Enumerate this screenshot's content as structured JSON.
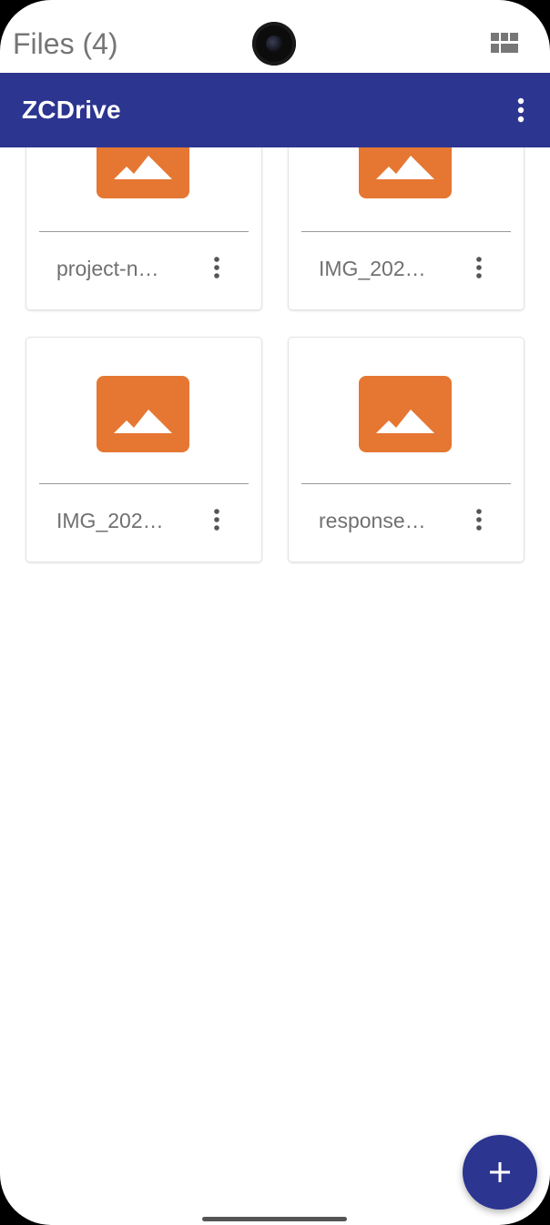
{
  "header": {
    "files_title": "Files (4)",
    "view_toggle_icon": "grid-view-icon"
  },
  "appbar": {
    "title": "ZCDrive",
    "menu_icon": "more-vert-icon",
    "color": "#2c3590"
  },
  "files": [
    {
      "name": "project-n…",
      "icon": "image-icon",
      "menu_icon": "more-vert-icon"
    },
    {
      "name": "IMG_202…",
      "icon": "image-icon",
      "menu_icon": "more-vert-icon"
    },
    {
      "name": "IMG_202…",
      "icon": "image-icon",
      "menu_icon": "more-vert-icon"
    },
    {
      "name": "response…",
      "icon": "image-icon",
      "menu_icon": "more-vert-icon"
    }
  ],
  "fab": {
    "icon": "add-icon",
    "color": "#2c3590"
  },
  "colors": {
    "thumbnail": "#e57733",
    "filename_text": "#707070"
  }
}
